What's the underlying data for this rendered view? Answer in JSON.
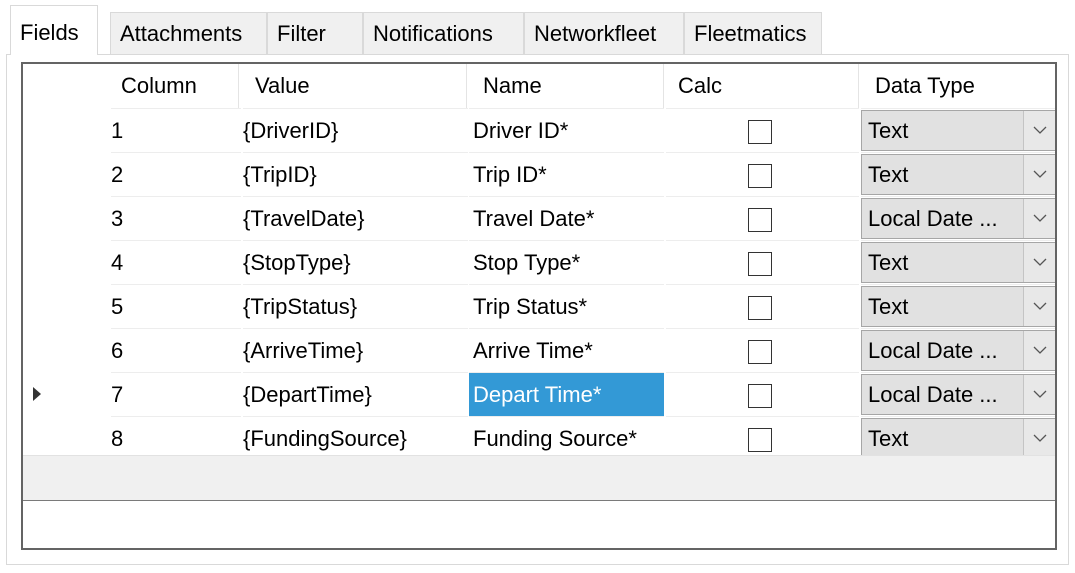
{
  "tabs": [
    {
      "label": "Fields",
      "active": true
    },
    {
      "label": "Attachments",
      "active": false
    },
    {
      "label": "Filter",
      "active": false
    },
    {
      "label": "Notifications",
      "active": false
    },
    {
      "label": "Networkfleet",
      "active": false
    },
    {
      "label": "Fleetmatics",
      "active": false
    }
  ],
  "grid": {
    "headers": {
      "column": "Column",
      "value": "Value",
      "name": "Name",
      "calc": "Calc",
      "data_type": "Data Type"
    },
    "rows": [
      {
        "column": "1",
        "value": "{DriverID}",
        "name": "Driver ID*",
        "calc": false,
        "data_type": "Text"
      },
      {
        "column": "2",
        "value": "{TripID}",
        "name": "Trip ID*",
        "calc": false,
        "data_type": "Text"
      },
      {
        "column": "3",
        "value": "{TravelDate}",
        "name": "Travel Date*",
        "calc": false,
        "data_type": "Local Date ..."
      },
      {
        "column": "4",
        "value": "{StopType}",
        "name": "Stop Type*",
        "calc": false,
        "data_type": "Text"
      },
      {
        "column": "5",
        "value": "{TripStatus}",
        "name": "Trip Status*",
        "calc": false,
        "data_type": "Text"
      },
      {
        "column": "6",
        "value": "{ArriveTime}",
        "name": "Arrive Time*",
        "calc": false,
        "data_type": "Local Date ..."
      },
      {
        "column": "7",
        "value": "{DepartTime}",
        "name": "Depart Time*",
        "calc": false,
        "data_type": "Local Date ...",
        "current": true,
        "name_selected": true
      },
      {
        "column": "8",
        "value": "{FundingSource}",
        "name": "Funding Source*",
        "calc": false,
        "data_type": "Text"
      }
    ]
  },
  "colors": {
    "selection": "#3399d6",
    "combo_background": "#e1e1e1",
    "grid_border": "#646464"
  },
  "icons": {
    "current_row": "row-indicator-icon",
    "dropdown": "chevron-down-icon"
  }
}
